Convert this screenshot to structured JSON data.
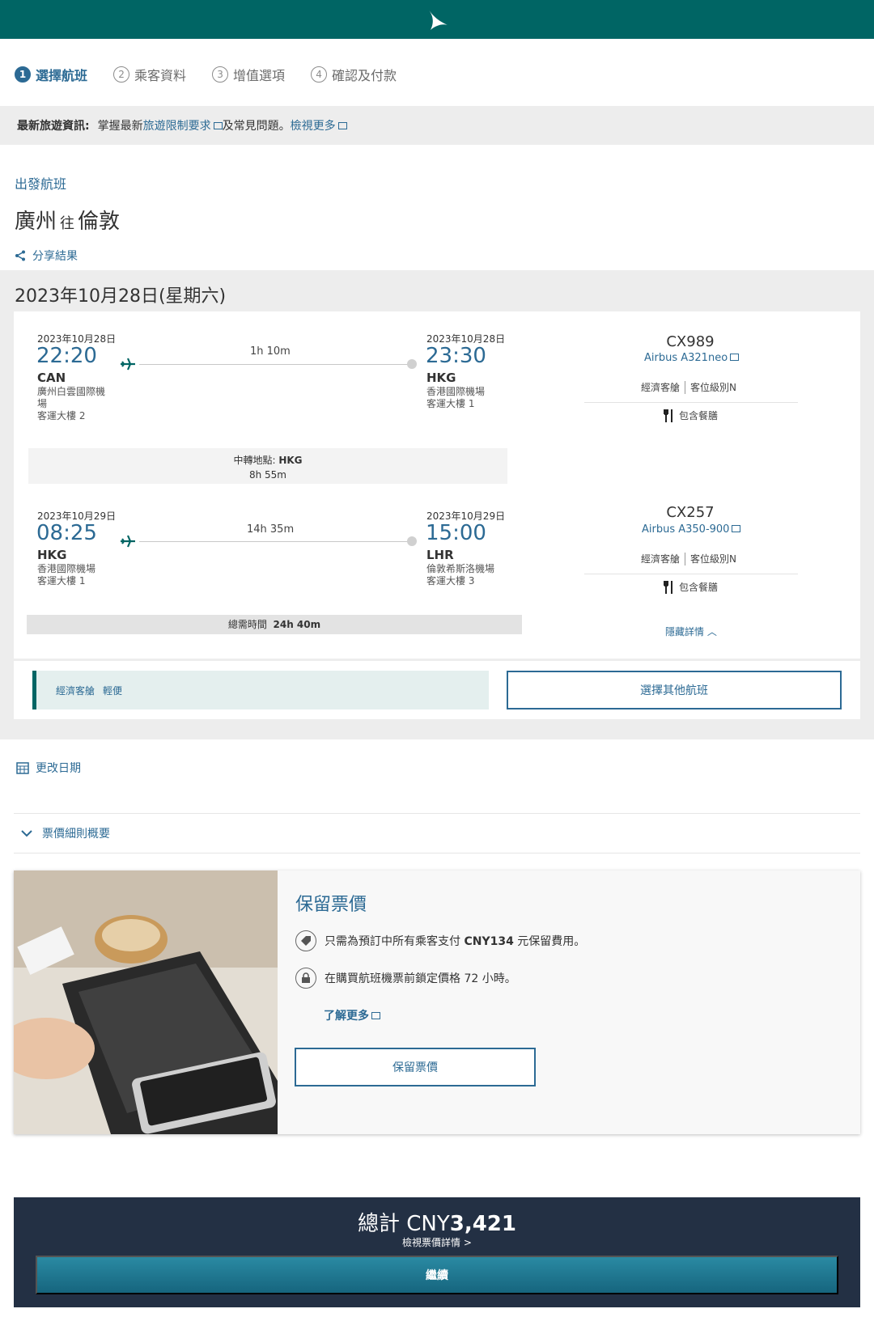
{
  "steps": [
    {
      "num": "1",
      "label": "選擇航班"
    },
    {
      "num": "2",
      "label": "乘客資料"
    },
    {
      "num": "3",
      "label": "增值選項"
    },
    {
      "num": "4",
      "label": "確認及付款"
    }
  ],
  "notice": {
    "label": "最新旅遊資訊:",
    "text1": "掌握最新",
    "link1": "旅遊限制要求",
    "text2": "及常見問題。",
    "link2": "檢視更多"
  },
  "outbound": {
    "label": "出發航班",
    "origin": "廣州",
    "to": "往",
    "destination": "倫敦",
    "share": "分享結果",
    "date_header": "2023年10月28日(星期六)"
  },
  "segments": [
    {
      "dep_date": "2023年10月28日",
      "dep_time": "22:20",
      "dep_code": "CAN",
      "dep_airport_l1": "廣州白雲國際機",
      "dep_airport_l2": "場",
      "dep_terminal": "客運大樓 2",
      "duration": "1h 10m",
      "arr_date": "2023年10月28日",
      "arr_time": "23:30",
      "arr_code": "HKG",
      "arr_airport": "香港國際機場",
      "arr_terminal": "客運大樓 1",
      "flight": "CX989",
      "aircraft": "Airbus A321neo",
      "cabin": "經濟客艙",
      "class": "客位級別N",
      "meal": "包含餐膳"
    },
    {
      "dep_date": "2023年10月29日",
      "dep_time": "08:25",
      "dep_code": "HKG",
      "dep_airport_l1": "香港國際機場",
      "dep_terminal": "客運大樓 1",
      "duration": "14h 35m",
      "arr_date": "2023年10月29日",
      "arr_time": "15:00",
      "arr_code": "LHR",
      "arr_airport": "倫敦希斯洛機場",
      "arr_terminal": "客運大樓 3",
      "flight": "CX257",
      "aircraft": "Airbus A350-900",
      "cabin": "經濟客艙",
      "class": "客位級別N",
      "meal": "包含餐膳"
    }
  ],
  "transit": {
    "label": "中轉地點:",
    "code": "HKG",
    "time": "8h 55m"
  },
  "total_time": {
    "label": "總需時間",
    "value": "24h 40m"
  },
  "hide_detail": "隱藏詳情",
  "fare": {
    "cabin": "經濟客艙",
    "type": "輕便"
  },
  "other_flights": "選擇其他航班",
  "change_date": "更改日期",
  "fare_rules": "票價細則概要",
  "hold": {
    "title": "保留票價",
    "item1_pre": "只需為預訂中所有乘客支付 ",
    "item1_amount": "CNY134",
    "item1_post": " 元保留費用。",
    "item2": "在購買航班機票前鎖定價格 72 小時。",
    "learn_more": "了解更多",
    "button": "保留票價"
  },
  "total": {
    "label": "總計 CNY",
    "amount": "3,421",
    "view_fare": "檢視票價詳情",
    "continue": "繼續"
  },
  "colors": {
    "brand": "#006564",
    "link": "#2c6a94",
    "footer": "#233044"
  }
}
